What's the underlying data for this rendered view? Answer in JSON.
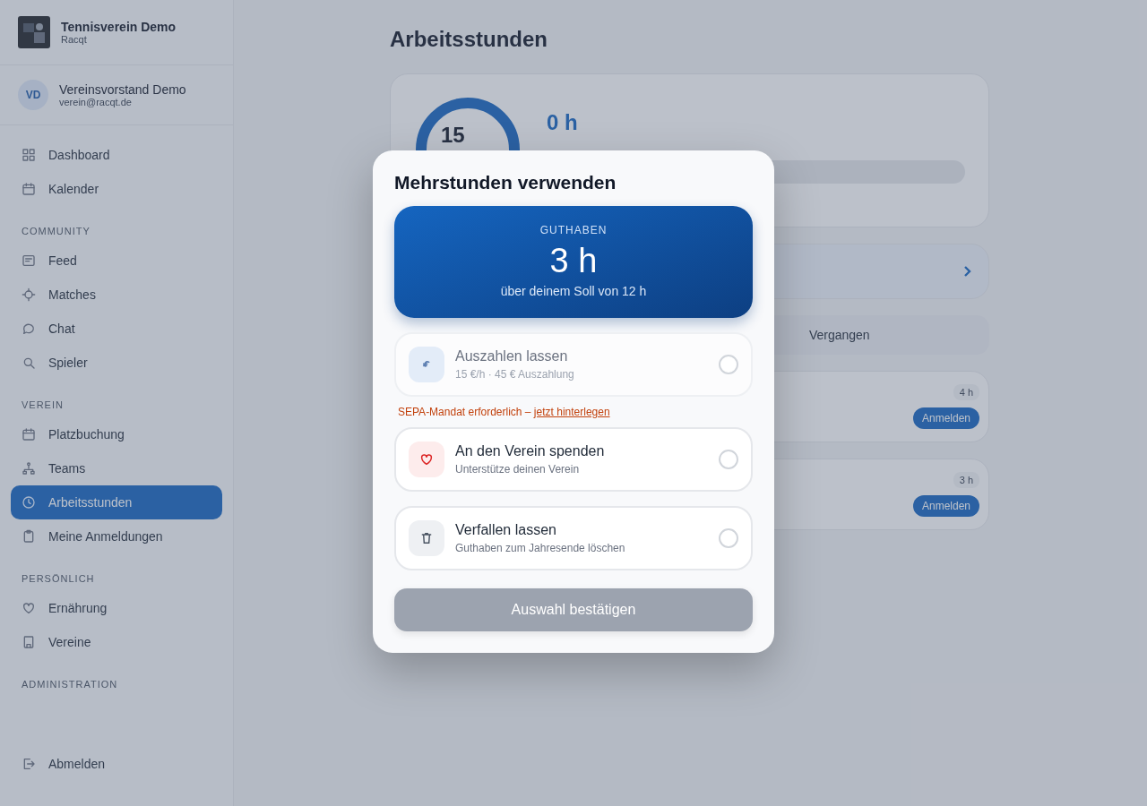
{
  "sidebar": {
    "club": {
      "name": "Tennisverein Demo",
      "subtitle": "Racqt"
    },
    "user": {
      "initials": "VD",
      "name": "Vereinsvorstand Demo",
      "email": "verein@racqt.de"
    },
    "sections": [
      {
        "items": [
          {
            "label": "Dashboard",
            "kind": "grid",
            "selected": false
          },
          {
            "label": "Kalender",
            "kind": "calendar",
            "selected": false
          }
        ]
      },
      {
        "title": "COMMUNITY",
        "items": [
          {
            "label": "Feed",
            "kind": "feed",
            "selected": false
          },
          {
            "label": "Matches",
            "kind": "target",
            "selected": false
          },
          {
            "label": "Chat",
            "kind": "chat",
            "selected": false
          },
          {
            "label": "Spieler",
            "kind": "search",
            "selected": false
          }
        ]
      },
      {
        "title": "VEREIN",
        "items": [
          {
            "label": "Platzbuchung",
            "kind": "calendar",
            "selected": false
          },
          {
            "label": "Teams",
            "kind": "network",
            "selected": false
          },
          {
            "label": "Arbeitsstunden",
            "kind": "clock",
            "selected": true
          },
          {
            "label": "Meine Anmeldungen",
            "kind": "clipboard",
            "selected": false
          }
        ]
      },
      {
        "title": "PERSÖNLICH",
        "items": [
          {
            "label": "Ernährung",
            "kind": "heart",
            "selected": false
          },
          {
            "label": "Vereine",
            "kind": "building",
            "selected": false
          }
        ]
      },
      {
        "title": "ADMINISTRATION"
      }
    ],
    "logout": "Abmelden"
  },
  "page": {
    "title": "Arbeitsstunden",
    "summary": {
      "ring_value": "15",
      "hours": "0 h",
      "bar": {
        "level": 0
      }
    },
    "tabs": [
      {
        "label": "Vergangen"
      }
    ],
    "entries": [
      {
        "hours": "4 h",
        "action": "Anmelden"
      },
      {
        "hours": "3 h",
        "action": "Anmelden"
      }
    ]
  },
  "dialog": {
    "title": "Mehrstunden verwenden",
    "balance": {
      "label": "GUTHABEN",
      "value": "3 h",
      "caption": "über deinem Soll von 12 h"
    },
    "options": [
      {
        "kind": "payout",
        "title": "Auszahlen lassen",
        "subtitle": "15 €/h · 45 € Auszahlung",
        "disabled": true,
        "selected": false,
        "warning": "SEPA-Mandat erforderlich – ",
        "warning_link": "jetzt hinterlegen"
      },
      {
        "kind": "donate",
        "title": "An den Verein spenden",
        "subtitle": "Unterstütze deinen Verein",
        "disabled": false,
        "selected": false
      },
      {
        "kind": "expire",
        "title": "Verfallen lassen",
        "subtitle": "Guthaben zum Jahresende löschen",
        "disabled": false,
        "selected": false
      }
    ],
    "confirm": {
      "label": "Auswahl bestätigen",
      "disabled": true
    }
  }
}
